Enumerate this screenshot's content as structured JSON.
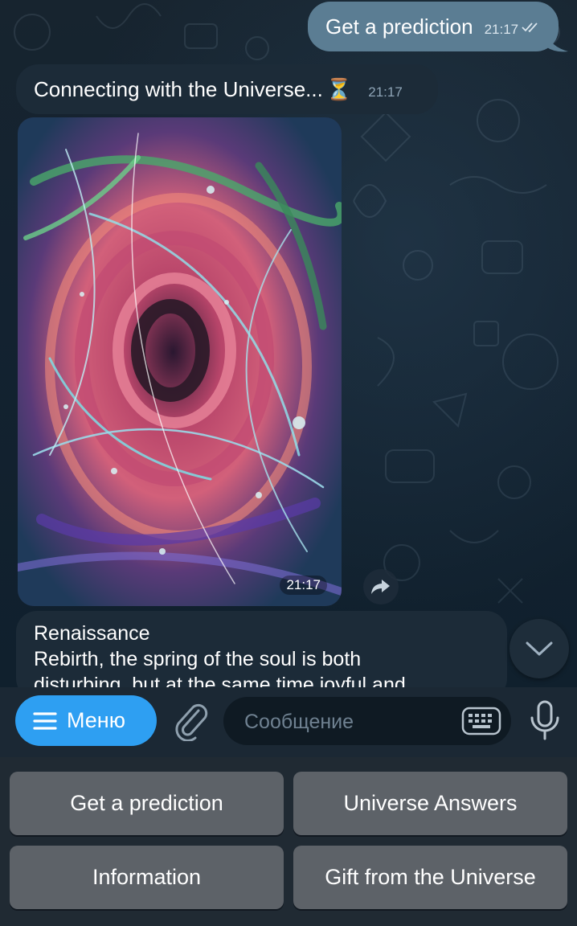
{
  "messages": {
    "outgoing": {
      "text": "Get a prediction",
      "time": "21:17"
    },
    "incoming": {
      "text": "Connecting with the Universe...",
      "emoji": "⏳",
      "time": "21:17"
    },
    "photo": {
      "time": "21:17"
    },
    "text_message": {
      "line1": "Renaissance",
      "line2": "Rebirth, the spring of the soul is both",
      "line3": "disturbing, but at the same time joyful and"
    }
  },
  "input_bar": {
    "menu_label": "Меню",
    "placeholder": "Сообщение"
  },
  "keyboard": {
    "buttons": [
      "Get a prediction",
      "Universe Answers",
      "Information",
      "Gift from the Universe"
    ]
  },
  "colors": {
    "outgoing_bubble": "#5b7d93",
    "incoming_bubble": "#1c2b38",
    "menu_button": "#2e9ff2",
    "keyboard_button": "#5d6268"
  }
}
